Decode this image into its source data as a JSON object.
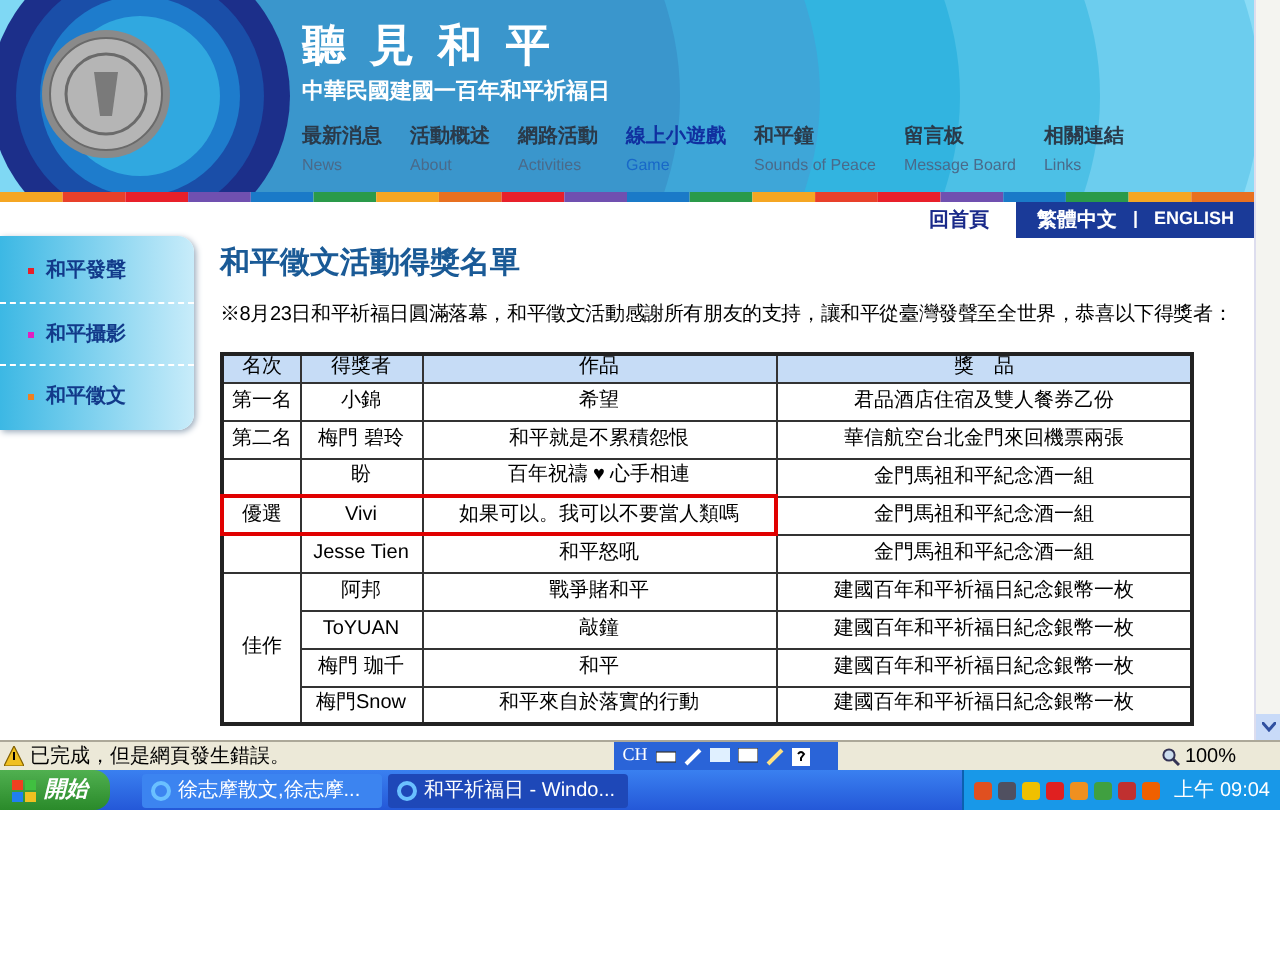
{
  "header": {
    "title": "聽見和平",
    "subtitle": "中華民國建國一百年和平祈福日",
    "nav": [
      {
        "label": "最新消息",
        "sub": "News",
        "selected": false
      },
      {
        "label": "活動概述",
        "sub": "About",
        "selected": false
      },
      {
        "label": "網路活動",
        "sub": "Activities",
        "selected": false
      },
      {
        "label": "線上小遊戲",
        "sub": "Game",
        "selected": true
      },
      {
        "label": "和平鐘",
        "sub": "Sounds of Peace",
        "selected": false
      },
      {
        "label": "留言板",
        "sub": "Message Board",
        "selected": false
      },
      {
        "label": "相關連結",
        "sub": "Links",
        "selected": false
      }
    ]
  },
  "top_links": {
    "home": "回首頁",
    "languages": [
      "繁體中文",
      "ENGLISH"
    ],
    "separator": "|"
  },
  "sidebar": {
    "items": [
      {
        "label": "和平發聲",
        "color": "#e8202a"
      },
      {
        "label": "和平攝影",
        "color": "#e020c0"
      },
      {
        "label": "和平徵文",
        "color": "#f08020"
      }
    ]
  },
  "page": {
    "title": "和平徵文活動得獎名單",
    "intro": "※8月23日和平祈福日圓滿落幕，和平徵文活動感謝所有朋友的支持，讓和平從臺灣發聲至全世界，恭喜以下得獎者：",
    "table": {
      "columns": [
        "名次",
        "得獎者",
        "作品",
        "獎　品"
      ],
      "groups": [
        {
          "rank": "第一名",
          "entries": [
            {
              "winner": "小錦",
              "work": "希望",
              "prize": "君品酒店住宿及雙人餐券乙份",
              "highlighted": false
            }
          ]
        },
        {
          "rank": "第二名",
          "entries": [
            {
              "winner": "梅門 碧玲",
              "work": "和平就是不累積怨恨",
              "prize": "華信航空台北金門來回機票兩張",
              "highlighted": false
            }
          ]
        },
        {
          "entries": [
            {
              "winner": "盼",
              "work": "百年祝禱 ♥ 心手相連",
              "prize": "金門馬祖和平紀念酒一組",
              "highlighted": false
            }
          ]
        },
        {
          "rank": "優選",
          "entries": [
            {
              "winner": "Vivi",
              "work": "如果可以。我可以不要當人類嗎",
              "prize": "金門馬祖和平紀念酒一組",
              "highlighted": true
            }
          ]
        },
        {
          "entries": [
            {
              "winner": "Jesse Tien",
              "work": "和平怒吼",
              "prize": "金門馬祖和平紀念酒一組",
              "highlighted": false
            }
          ]
        },
        {
          "rank": "佳作",
          "entries": [
            {
              "winner": "阿邦",
              "work": "戰爭賭和平",
              "prize": "建國百年和平祈福日紀念銀幣一枚",
              "highlighted": false
            },
            {
              "winner": "ToYUAN",
              "work": "敲鐘",
              "prize": "建國百年和平祈福日紀念銀幣一枚",
              "highlighted": false
            },
            {
              "winner": "梅門 珈千",
              "work": "和平",
              "prize": "建國百年和平祈福日紀念銀幣一枚",
              "highlighted": false
            },
            {
              "winner": "梅門Snow",
              "work": "和平來自於落實的行動",
              "prize": "建國百年和平祈福日紀念銀幣一枚",
              "highlighted": false
            }
          ]
        }
      ]
    }
  },
  "status_bar": {
    "message": "已完成，但是網頁發生錯誤。",
    "language": "CH",
    "zoom": "100%"
  },
  "taskbar": {
    "start": "開始",
    "tasks": [
      {
        "label": "徐志摩散文,徐志摩...",
        "selected": false
      },
      {
        "label": "和平祈福日 - Windo...",
        "selected": true
      }
    ],
    "clock": "上午 09:04"
  }
}
